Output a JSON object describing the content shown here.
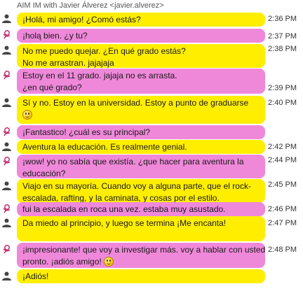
{
  "header": {
    "title": "AIM IM with Javier Álverez <javier.alverez>"
  },
  "messages": [
    {
      "sender": "self",
      "lines": [
        "¡Holá, mi amigo! ¿Comó estás?"
      ],
      "time": "2:36 PM"
    },
    {
      "sender": "other",
      "lines": [
        "¡holą bien. ¿y tu?"
      ],
      "time": "2:37 PM"
    },
    {
      "sender": "self",
      "lines": [
        "No me puedo quejar. ¿En qué grado estás?",
        "No me arrastran. jajajaja"
      ],
      "time": "2:38 PM"
    },
    {
      "sender": "other",
      "lines": [
        "Estoy en el 11 grado. jajaja no es arrasta.",
        "¿en qué grado?"
      ],
      "time": "2:39 PM"
    },
    {
      "sender": "self",
      "lines": [
        "Sí y no. Estoy en la universidad. Estoy a punto de graduarse"
      ],
      "smiley_line": true,
      "time": "2:40 PM"
    },
    {
      "sender": "other",
      "lines": [
        "¡Fantastico! ¿cuál es su principal?"
      ],
      "time": ""
    },
    {
      "sender": "self",
      "lines": [
        "Aventura la educación. Es realmente genial."
      ],
      "time": "2:42 PM"
    },
    {
      "sender": "other",
      "lines": [
        "¡wow! yo no sabía que existía. ¿que hacer para aventura la",
        "educación?"
      ],
      "time": "2:44 PM"
    },
    {
      "sender": "self",
      "lines": [
        "Viajo en su mayoría. Cuando voy a alguna parte, que el rock-",
        "escalada, rafting, y la caminata, y cosas por el estilo."
      ],
      "time": "2:45 PM"
    },
    {
      "sender": "other",
      "lines": [
        "fui la escalada en roca una vez. estaba muy asustado."
      ],
      "time": "2:46 PM"
    },
    {
      "sender": "self",
      "lines": [
        "Da miedo al principio, y luego se termina ¡Me encanta!"
      ],
      "time": "2:47 PM"
    },
    {
      "sender": "other",
      "lines": [
        "¡impresionante! que voy a investigar más. voy a hablar con usted",
        "pronto. ¡adiós amigo!"
      ],
      "smiley_inline": true,
      "time": "2:48 PM"
    },
    {
      "sender": "self",
      "lines": [
        "¡Adiós!"
      ],
      "time": ""
    }
  ],
  "colors": {
    "self_bubble": "#ffee00",
    "other_bubble": "#f088da"
  },
  "icons": {
    "self": "person-silhouette-icon",
    "other": "buddy-running-man-icon"
  }
}
